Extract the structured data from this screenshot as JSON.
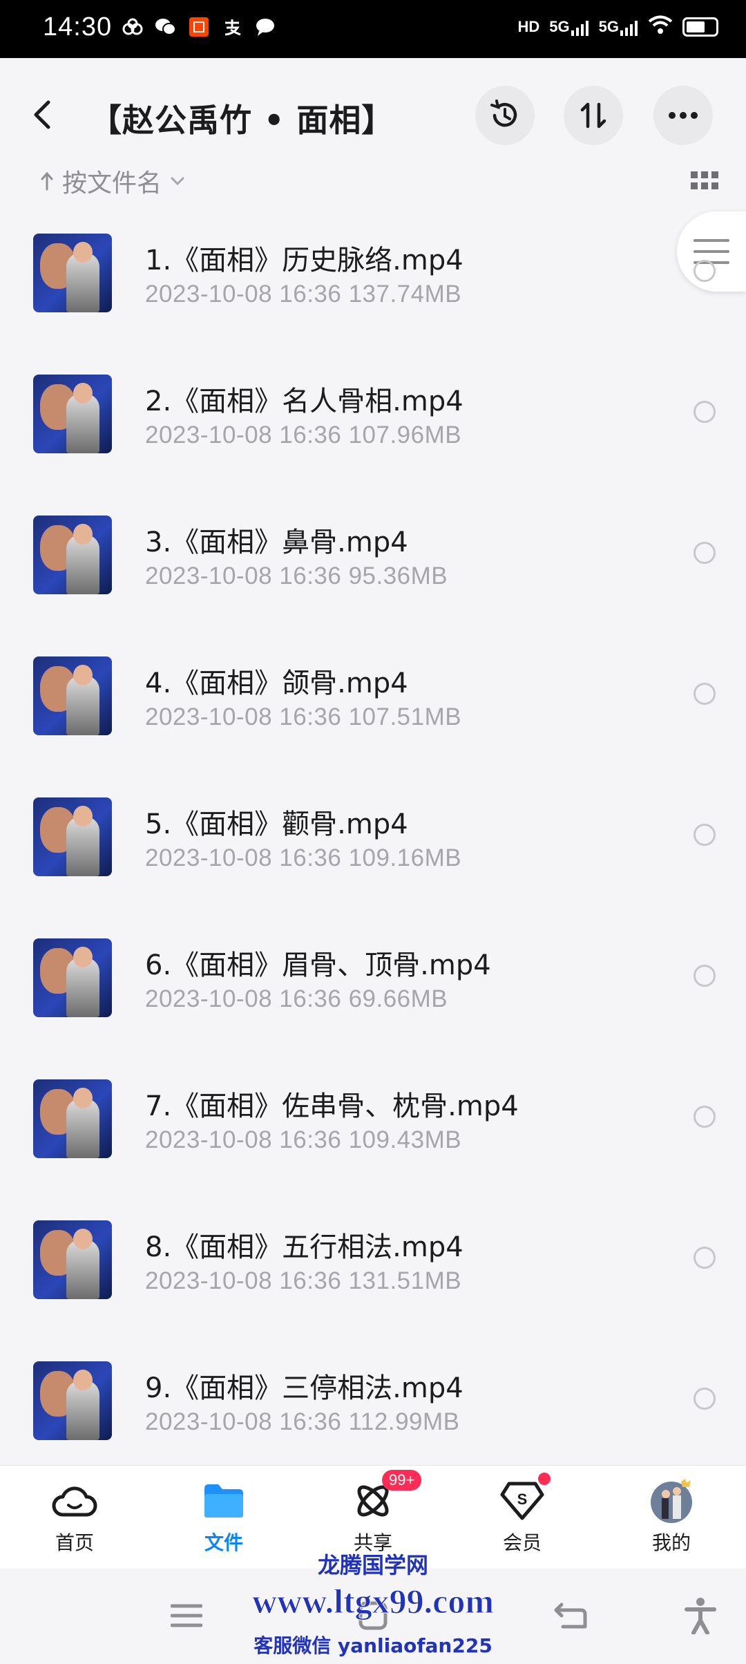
{
  "status": {
    "time": "14:30",
    "network": [
      "HD",
      "5G",
      "5G"
    ]
  },
  "header": {
    "title": "【赵公禹竹 • 面相】"
  },
  "sort": {
    "label": "按文件名"
  },
  "files": [
    {
      "name": "1.《面相》历史脉络.mp4",
      "meta": "2023-10-08  16:36  137.74MB"
    },
    {
      "name": "2.《面相》名人骨相.mp4",
      "meta": "2023-10-08  16:36  107.96MB"
    },
    {
      "name": "3.《面相》鼻骨.mp4",
      "meta": "2023-10-08  16:36  95.36MB"
    },
    {
      "name": "4.《面相》颌骨.mp4",
      "meta": "2023-10-08  16:36  107.51MB"
    },
    {
      "name": "5.《面相》颧骨.mp4",
      "meta": "2023-10-08  16:36  109.16MB"
    },
    {
      "name": "6.《面相》眉骨、顶骨.mp4",
      "meta": "2023-10-08  16:36  69.66MB"
    },
    {
      "name": "7.《面相》佐串骨、枕骨.mp4",
      "meta": "2023-10-08  16:36  109.43MB"
    },
    {
      "name": "8.《面相》五行相法.mp4",
      "meta": "2023-10-08  16:36  131.51MB"
    },
    {
      "name": "9.《面相》三停相法.mp4",
      "meta": "2023-10-08  16:36  112.99MB"
    }
  ],
  "tabs": [
    {
      "label": "首页",
      "icon": "cloud-icon"
    },
    {
      "label": "文件",
      "icon": "folder-icon",
      "active": true
    },
    {
      "label": "共享",
      "icon": "share-atom-icon",
      "badge": "99+"
    },
    {
      "label": "会员",
      "icon": "vip-diamond-icon"
    },
    {
      "label": "我的",
      "icon": "avatar"
    }
  ],
  "watermark": {
    "line1": "龙腾国学网",
    "line2": "www.ltgx99.com",
    "line3": "客服微信 yanliaofan225"
  },
  "colors": {
    "accent": "#0a84ff",
    "badge": "#ff2d55"
  }
}
